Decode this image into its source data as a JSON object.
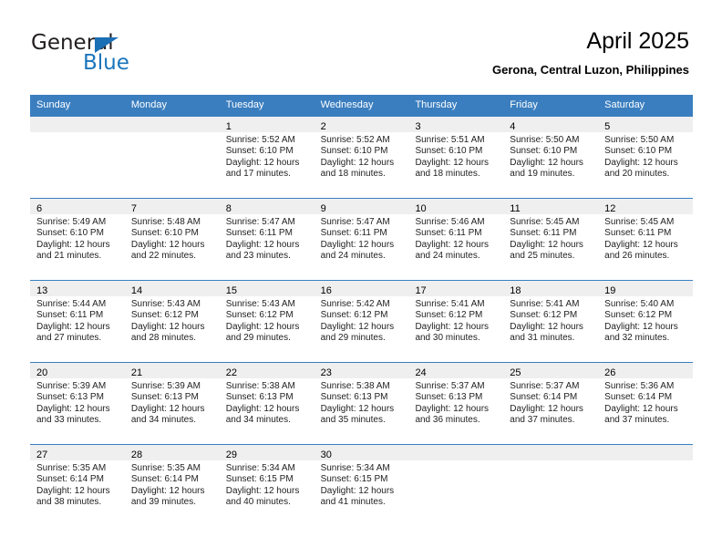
{
  "logo": {
    "word_top": "General",
    "word_bottom": "Blue",
    "triangle_icon": "triangle-icon",
    "brand_color": "#1b75bb"
  },
  "header": {
    "title": "April 2025",
    "subtitle": "Gerona, Central Luzon, Philippines"
  },
  "colors": {
    "header_row": "#3a7ebf",
    "day_band": "#efeff0",
    "text": "#000000"
  },
  "weekdays": [
    "Sunday",
    "Monday",
    "Tuesday",
    "Wednesday",
    "Thursday",
    "Friday",
    "Saturday"
  ],
  "weeks": [
    [
      {
        "day": "",
        "sunrise": "",
        "sunset": "",
        "daylight1": "",
        "daylight2": ""
      },
      {
        "day": "",
        "sunrise": "",
        "sunset": "",
        "daylight1": "",
        "daylight2": ""
      },
      {
        "day": "1",
        "sunrise": "Sunrise: 5:52 AM",
        "sunset": "Sunset: 6:10 PM",
        "daylight1": "Daylight: 12 hours",
        "daylight2": "and 17 minutes."
      },
      {
        "day": "2",
        "sunrise": "Sunrise: 5:52 AM",
        "sunset": "Sunset: 6:10 PM",
        "daylight1": "Daylight: 12 hours",
        "daylight2": "and 18 minutes."
      },
      {
        "day": "3",
        "sunrise": "Sunrise: 5:51 AM",
        "sunset": "Sunset: 6:10 PM",
        "daylight1": "Daylight: 12 hours",
        "daylight2": "and 18 minutes."
      },
      {
        "day": "4",
        "sunrise": "Sunrise: 5:50 AM",
        "sunset": "Sunset: 6:10 PM",
        "daylight1": "Daylight: 12 hours",
        "daylight2": "and 19 minutes."
      },
      {
        "day": "5",
        "sunrise": "Sunrise: 5:50 AM",
        "sunset": "Sunset: 6:10 PM",
        "daylight1": "Daylight: 12 hours",
        "daylight2": "and 20 minutes."
      }
    ],
    [
      {
        "day": "6",
        "sunrise": "Sunrise: 5:49 AM",
        "sunset": "Sunset: 6:10 PM",
        "daylight1": "Daylight: 12 hours",
        "daylight2": "and 21 minutes."
      },
      {
        "day": "7",
        "sunrise": "Sunrise: 5:48 AM",
        "sunset": "Sunset: 6:10 PM",
        "daylight1": "Daylight: 12 hours",
        "daylight2": "and 22 minutes."
      },
      {
        "day": "8",
        "sunrise": "Sunrise: 5:47 AM",
        "sunset": "Sunset: 6:11 PM",
        "daylight1": "Daylight: 12 hours",
        "daylight2": "and 23 minutes."
      },
      {
        "day": "9",
        "sunrise": "Sunrise: 5:47 AM",
        "sunset": "Sunset: 6:11 PM",
        "daylight1": "Daylight: 12 hours",
        "daylight2": "and 24 minutes."
      },
      {
        "day": "10",
        "sunrise": "Sunrise: 5:46 AM",
        "sunset": "Sunset: 6:11 PM",
        "daylight1": "Daylight: 12 hours",
        "daylight2": "and 24 minutes."
      },
      {
        "day": "11",
        "sunrise": "Sunrise: 5:45 AM",
        "sunset": "Sunset: 6:11 PM",
        "daylight1": "Daylight: 12 hours",
        "daylight2": "and 25 minutes."
      },
      {
        "day": "12",
        "sunrise": "Sunrise: 5:45 AM",
        "sunset": "Sunset: 6:11 PM",
        "daylight1": "Daylight: 12 hours",
        "daylight2": "and 26 minutes."
      }
    ],
    [
      {
        "day": "13",
        "sunrise": "Sunrise: 5:44 AM",
        "sunset": "Sunset: 6:11 PM",
        "daylight1": "Daylight: 12 hours",
        "daylight2": "and 27 minutes."
      },
      {
        "day": "14",
        "sunrise": "Sunrise: 5:43 AM",
        "sunset": "Sunset: 6:12 PM",
        "daylight1": "Daylight: 12 hours",
        "daylight2": "and 28 minutes."
      },
      {
        "day": "15",
        "sunrise": "Sunrise: 5:43 AM",
        "sunset": "Sunset: 6:12 PM",
        "daylight1": "Daylight: 12 hours",
        "daylight2": "and 29 minutes."
      },
      {
        "day": "16",
        "sunrise": "Sunrise: 5:42 AM",
        "sunset": "Sunset: 6:12 PM",
        "daylight1": "Daylight: 12 hours",
        "daylight2": "and 29 minutes."
      },
      {
        "day": "17",
        "sunrise": "Sunrise: 5:41 AM",
        "sunset": "Sunset: 6:12 PM",
        "daylight1": "Daylight: 12 hours",
        "daylight2": "and 30 minutes."
      },
      {
        "day": "18",
        "sunrise": "Sunrise: 5:41 AM",
        "sunset": "Sunset: 6:12 PM",
        "daylight1": "Daylight: 12 hours",
        "daylight2": "and 31 minutes."
      },
      {
        "day": "19",
        "sunrise": "Sunrise: 5:40 AM",
        "sunset": "Sunset: 6:12 PM",
        "daylight1": "Daylight: 12 hours",
        "daylight2": "and 32 minutes."
      }
    ],
    [
      {
        "day": "20",
        "sunrise": "Sunrise: 5:39 AM",
        "sunset": "Sunset: 6:13 PM",
        "daylight1": "Daylight: 12 hours",
        "daylight2": "and 33 minutes."
      },
      {
        "day": "21",
        "sunrise": "Sunrise: 5:39 AM",
        "sunset": "Sunset: 6:13 PM",
        "daylight1": "Daylight: 12 hours",
        "daylight2": "and 34 minutes."
      },
      {
        "day": "22",
        "sunrise": "Sunrise: 5:38 AM",
        "sunset": "Sunset: 6:13 PM",
        "daylight1": "Daylight: 12 hours",
        "daylight2": "and 34 minutes."
      },
      {
        "day": "23",
        "sunrise": "Sunrise: 5:38 AM",
        "sunset": "Sunset: 6:13 PM",
        "daylight1": "Daylight: 12 hours",
        "daylight2": "and 35 minutes."
      },
      {
        "day": "24",
        "sunrise": "Sunrise: 5:37 AM",
        "sunset": "Sunset: 6:13 PM",
        "daylight1": "Daylight: 12 hours",
        "daylight2": "and 36 minutes."
      },
      {
        "day": "25",
        "sunrise": "Sunrise: 5:37 AM",
        "sunset": "Sunset: 6:14 PM",
        "daylight1": "Daylight: 12 hours",
        "daylight2": "and 37 minutes."
      },
      {
        "day": "26",
        "sunrise": "Sunrise: 5:36 AM",
        "sunset": "Sunset: 6:14 PM",
        "daylight1": "Daylight: 12 hours",
        "daylight2": "and 37 minutes."
      }
    ],
    [
      {
        "day": "27",
        "sunrise": "Sunrise: 5:35 AM",
        "sunset": "Sunset: 6:14 PM",
        "daylight1": "Daylight: 12 hours",
        "daylight2": "and 38 minutes."
      },
      {
        "day": "28",
        "sunrise": "Sunrise: 5:35 AM",
        "sunset": "Sunset: 6:14 PM",
        "daylight1": "Daylight: 12 hours",
        "daylight2": "and 39 minutes."
      },
      {
        "day": "29",
        "sunrise": "Sunrise: 5:34 AM",
        "sunset": "Sunset: 6:15 PM",
        "daylight1": "Daylight: 12 hours",
        "daylight2": "and 40 minutes."
      },
      {
        "day": "30",
        "sunrise": "Sunrise: 5:34 AM",
        "sunset": "Sunset: 6:15 PM",
        "daylight1": "Daylight: 12 hours",
        "daylight2": "and 41 minutes."
      },
      {
        "day": "",
        "sunrise": "",
        "sunset": "",
        "daylight1": "",
        "daylight2": ""
      },
      {
        "day": "",
        "sunrise": "",
        "sunset": "",
        "daylight1": "",
        "daylight2": ""
      },
      {
        "day": "",
        "sunrise": "",
        "sunset": "",
        "daylight1": "",
        "daylight2": ""
      }
    ]
  ]
}
